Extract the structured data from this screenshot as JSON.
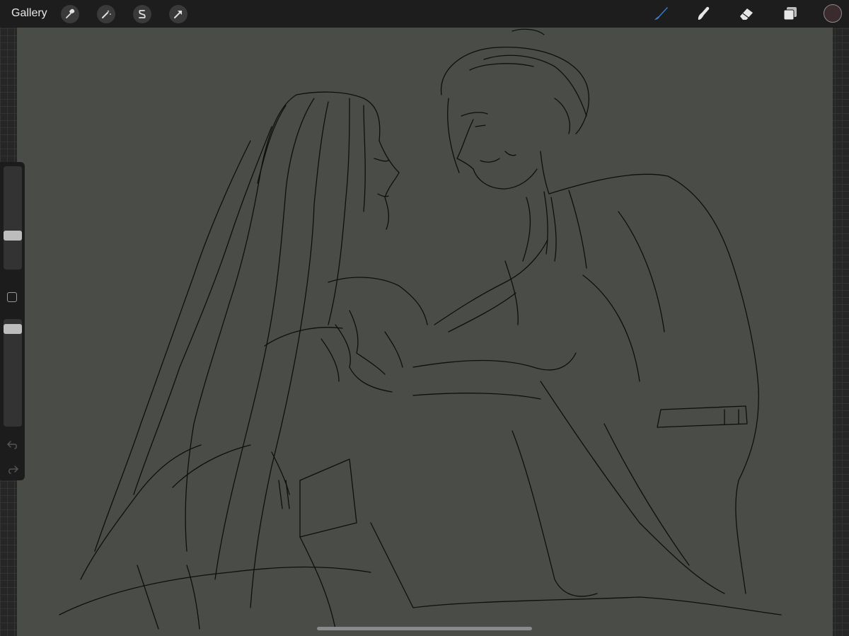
{
  "topbar": {
    "gallery_label": "Gallery",
    "left_tools": [
      "wrench-icon",
      "magic-wand-icon",
      "selection-s-icon",
      "transform-arrow-icon"
    ],
    "right_tools": [
      "brush-icon",
      "smudge-icon",
      "eraser-icon",
      "layers-icon"
    ],
    "active_tool": "brush-icon",
    "brush_color": "#3a7bd5",
    "current_color": "#3b2a2e"
  },
  "canvas": {
    "background_color": "#4a4d47",
    "line_color": "#0d0f0c",
    "subject": "line-art-sketch"
  },
  "sidebar": {
    "brush_size": 0.33,
    "brush_opacity": 0.96,
    "undo_icon": "undo-icon",
    "redo_icon": "redo-icon"
  }
}
